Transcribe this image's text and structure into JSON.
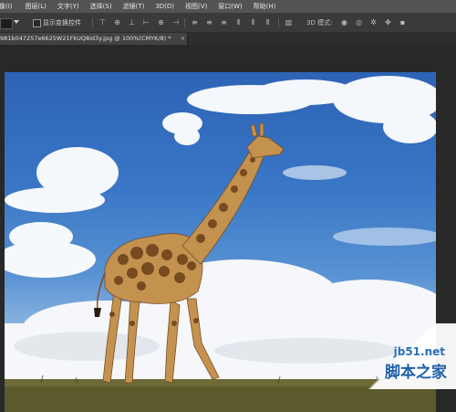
{
  "menubar": {
    "items": [
      {
        "label": "像(I)"
      },
      {
        "label": "图层(L)"
      },
      {
        "label": "文字(Y)"
      },
      {
        "label": "选择(S)"
      },
      {
        "label": "滤镜(T)"
      },
      {
        "label": "3D(D)"
      },
      {
        "label": "视图(V)"
      },
      {
        "label": "窗口(W)"
      },
      {
        "label": "帮助(H)"
      }
    ]
  },
  "options": {
    "show_transform_label": "显示变换控件",
    "mode_label": "3D 模式:"
  },
  "document": {
    "tab_title": "981b047257e6625W21FkUQ8id3y.jpg @ 100%(CMYK/8) *",
    "close_glyph": "×"
  },
  "watermark": {
    "url": "jb51.net",
    "text": "脚本之家"
  },
  "colors": {
    "menubar_bg": "#535353",
    "optionsbar_bg": "#3a3a3a",
    "workspace_bg": "#282828",
    "watermark_blue": "#1f60a8"
  }
}
